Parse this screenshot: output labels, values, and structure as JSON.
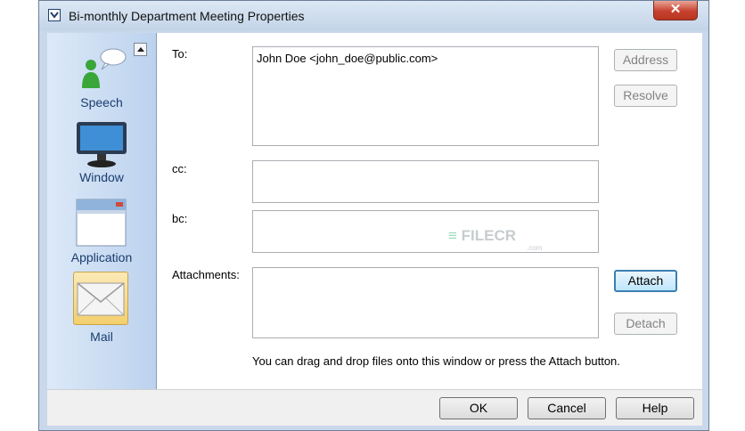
{
  "window": {
    "title": "Bi-monthly Department Meeting Properties",
    "close_glyph": "✕"
  },
  "sidebar": {
    "items": [
      {
        "label": "Speech",
        "icon": "speech-icon"
      },
      {
        "label": "Window",
        "icon": "monitor-icon"
      },
      {
        "label": "Application",
        "icon": "application-icon"
      },
      {
        "label": "Mail",
        "icon": "mail-icon"
      }
    ],
    "selected": "Mail"
  },
  "form": {
    "to_label": "To:",
    "to_value": "John Doe <john_doe@public.com>",
    "cc_label": "cc:",
    "cc_value": "",
    "bc_label": "bc:",
    "bc_value": "",
    "attachments_label": "Attachments:",
    "hint": "You can drag and drop files onto this window or press the Attach button."
  },
  "buttons": {
    "address": "Address",
    "resolve": "Resolve",
    "attach": "Attach",
    "detach": "Detach",
    "ok": "OK",
    "cancel": "Cancel",
    "help": "Help"
  },
  "watermark": {
    "text": "FILECR",
    "sub": ".com"
  },
  "colors": {
    "title_bg": "#c3d4e8",
    "close_red": "#c7412f",
    "sidebar_label": "#1a3d6e",
    "selected_item": "#f6d98a"
  }
}
